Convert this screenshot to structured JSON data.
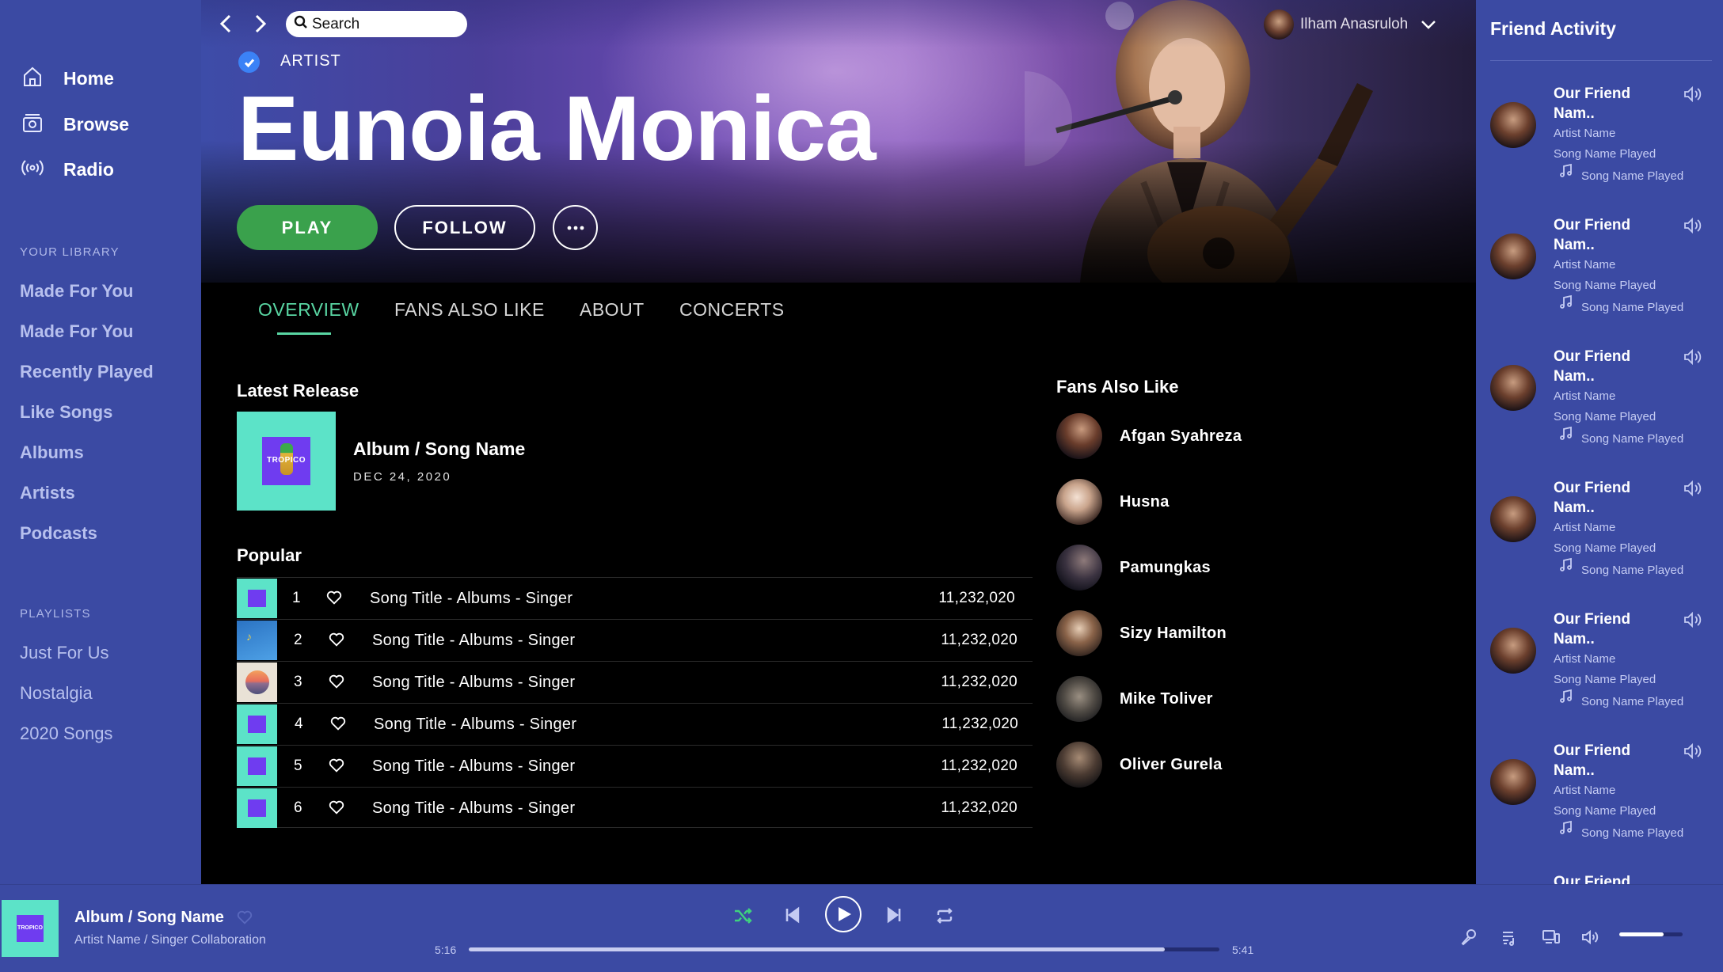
{
  "sidebar": {
    "nav": [
      {
        "label": "Home",
        "icon": "home-icon"
      },
      {
        "label": "Browse",
        "icon": "browse-icon"
      },
      {
        "label": "Radio",
        "icon": "radio-icon"
      }
    ],
    "library_heading": "YOUR LIBRARY",
    "library": [
      "Made For You",
      "Made For You",
      "Recently Played",
      "Like Songs",
      "Albums",
      "Artists",
      "Podcasts"
    ],
    "playlists_heading": "PLAYLISTS",
    "playlists": [
      "Just For Us",
      "Nostalgia",
      "2020 Songs"
    ]
  },
  "header": {
    "search_placeholder": "Search",
    "user_name": "Ilham Anasruloh"
  },
  "artist": {
    "tag": "ARTIST",
    "name": "Eunoia Monica",
    "play_label": "PLAY",
    "follow_label": "FOLLOW"
  },
  "tabs": [
    {
      "label": "OVERVIEW",
      "active": true
    },
    {
      "label": "FANS ALSO LIKE",
      "active": false
    },
    {
      "label": "ABOUT",
      "active": false
    },
    {
      "label": "CONCERTS",
      "active": false
    }
  ],
  "latest_release": {
    "heading": "Latest Release",
    "cover_text": "TROPICO",
    "title": "Album / Song Name",
    "date": "DEC 24, 2020"
  },
  "popular": {
    "heading": "Popular",
    "tracks": [
      {
        "num": "1",
        "title": "Song Title - Albums - Singer",
        "plays": "11,232,020",
        "cover": "tropico"
      },
      {
        "num": "2",
        "title": "Song Title - Albums - Singer",
        "plays": "11,232,020",
        "cover": "blue-script"
      },
      {
        "num": "3",
        "title": "Song Title - Albums - Singer",
        "plays": "11,232,020",
        "cover": "sunset"
      },
      {
        "num": "4",
        "title": "Song Title - Albums - Singer",
        "plays": "11,232,020",
        "cover": "tropico"
      },
      {
        "num": "5",
        "title": "Song Title - Albums - Singer",
        "plays": "11,232,020",
        "cover": "tropico"
      },
      {
        "num": "6",
        "title": "Song Title - Albums - Singer",
        "plays": "11,232,020",
        "cover": "tropico"
      }
    ]
  },
  "fans_also_like": {
    "heading": "Fans Also Like",
    "artists": [
      "Afgan Syahreza",
      "Husna",
      "Pamungkas",
      "Sizy Hamilton",
      "Mike Toliver",
      "Oliver Gurela"
    ]
  },
  "friend_activity": {
    "title": "Friend Activity",
    "friends": [
      {
        "name": "Our Friend Nam..",
        "artist": "Artist Name",
        "song": "Song Name Played",
        "now": "Song Name Played"
      },
      {
        "name": "Our Friend Nam..",
        "artist": "Artist Name",
        "song": "Song Name Played",
        "now": "Song Name Played"
      },
      {
        "name": "Our Friend Nam..",
        "artist": "Artist Name",
        "song": "Song Name Played",
        "now": "Song Name Played"
      },
      {
        "name": "Our Friend Nam..",
        "artist": "Artist Name",
        "song": "Song Name Played",
        "now": "Song Name Played"
      },
      {
        "name": "Our Friend Nam..",
        "artist": "Artist Name",
        "song": "Song Name Played",
        "now": "Song Name Played"
      },
      {
        "name": "Our Friend Nam..",
        "artist": "Artist Name",
        "song": "Song Name Played",
        "now": "Song Name Played"
      },
      {
        "name": "Our Friend",
        "artist": "",
        "song": "",
        "now": ""
      }
    ]
  },
  "player": {
    "cover_text": "TROPICO",
    "title": "Album / Song Name",
    "artist": "Artist Name / Singer Collaboration",
    "current_time": "5:16",
    "total_time": "5:41",
    "progress": 0.927,
    "volume": 0.7
  },
  "colors": {
    "panel": "#3b4aa3",
    "accent_green": "#3aa14c",
    "tab_active": "#59d6a3",
    "shuffle_active": "#3fd27e"
  }
}
